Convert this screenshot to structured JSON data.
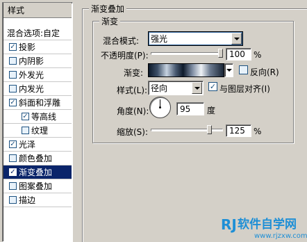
{
  "sidebar": {
    "header": "样式",
    "blend_options": "混合选项:自定",
    "items": [
      {
        "label": "投影",
        "checked": true
      },
      {
        "label": "内阴影",
        "checked": false
      },
      {
        "label": "外发光",
        "checked": false
      },
      {
        "label": "内发光",
        "checked": false
      },
      {
        "label": "斜面和浮雕",
        "checked": true
      },
      {
        "label": "等高线",
        "checked": true,
        "sub": true
      },
      {
        "label": "纹理",
        "checked": false,
        "sub": true
      },
      {
        "label": "光泽",
        "checked": true
      },
      {
        "label": "颜色叠加",
        "checked": false
      },
      {
        "label": "渐变叠加",
        "checked": true,
        "selected": true
      },
      {
        "label": "图案叠加",
        "checked": false
      },
      {
        "label": "描边",
        "checked": false
      }
    ]
  },
  "panel": {
    "outer_title": "渐变叠加",
    "inner_title": "渐变",
    "blend_mode_label": "混合模式:",
    "blend_mode_value": "强光",
    "opacity_label": "不透明度(P):",
    "opacity_value": "100",
    "opacity_unit": "%",
    "opacity_level": 1.0,
    "gradient_label": "渐变:",
    "reverse_label": "反向(R)",
    "reverse_checked": false,
    "style_label": "样式(L):",
    "style_value": "径向",
    "align_label": "与图层对齐(I)",
    "align_checked": true,
    "angle_label": "角度(N):",
    "angle_value": "95",
    "angle_unit": "度",
    "scale_label": "缩放(S):",
    "scale_value": "125",
    "scale_unit": "%",
    "scale_level": 0.83
  },
  "watermark": {
    "logo": "RJ",
    "title": "软件自学网",
    "url": "www.rjzxw.com"
  }
}
